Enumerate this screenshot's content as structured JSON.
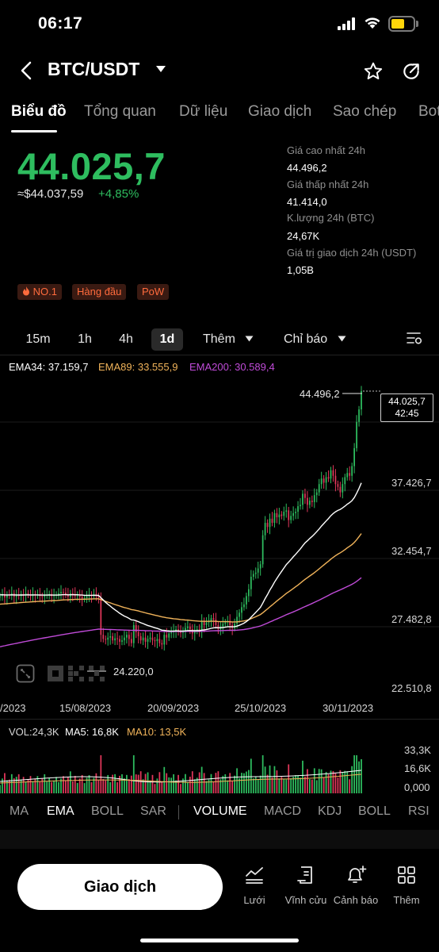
{
  "status_bar": {
    "time": "06:17"
  },
  "header": {
    "title": "BTC/USDT"
  },
  "tabs": [
    {
      "label": "Biểu đồ"
    },
    {
      "label": "Tổng quan"
    },
    {
      "label": "Dữ liệu"
    },
    {
      "label": "Giao dịch"
    },
    {
      "label": "Sao chép"
    },
    {
      "label": "Bot"
    }
  ],
  "price": {
    "last": "44.025,7",
    "usd": "≈$44.037,59",
    "change": "+4,85%",
    "up_color": "#2ebd5f"
  },
  "stats": [
    {
      "label": "Giá cao nhất 24h",
      "value": "44.496,2"
    },
    {
      "label": "Giá thấp nhất 24h",
      "value": "41.414,0"
    },
    {
      "label": "K.lượng 24h (BTC)",
      "value": "24,67K"
    },
    {
      "label": "Giá trị giao dịch 24h (USDT)",
      "value": "1,05B"
    }
  ],
  "badges": [
    {
      "label": "NO.1",
      "icon": "flame-icon"
    },
    {
      "label": "Hàng đầu"
    },
    {
      "label": "PoW"
    }
  ],
  "intervals": {
    "items": [
      "15m",
      "1h",
      "4h",
      "1d"
    ],
    "selected": "1d",
    "more_label": "Thêm",
    "indicator_label": "Chỉ báo"
  },
  "ema_legend": {
    "ema34": "EMA34: 37.159,7",
    "ema89": "EMA89: 33.555,9",
    "ema200": "EMA200: 30.589,4",
    "colors": {
      "ema34": "#ffffff",
      "ema89": "#f0b35a",
      "ema200": "#c04bd8"
    }
  },
  "chart": {
    "y_labels": [
      "37.426,7",
      "32.454,7",
      "27.482,8",
      "22.510,8"
    ],
    "x_labels": [
      "/2023",
      "15/08/2023",
      "20/09/2023",
      "25/10/2023",
      "30/11/2023"
    ],
    "last_price_tag": "44.025,7",
    "countdown": "42:45",
    "high_label": "44.496,2",
    "low_label": "24.220,0",
    "watermark": "OKX"
  },
  "chart_data": {
    "type": "candlestick",
    "title": "",
    "ylim": [
      22510.8,
      44496.2
    ],
    "y_ticks": [
      37426.7,
      32454.7,
      27482.8,
      22510.8
    ],
    "x_ticks": [
      "/2023",
      "15/08/2023",
      "20/09/2023",
      "25/10/2023",
      "30/11/2023"
    ],
    "close_series": [
      29200,
      29350,
      29100,
      29300,
      29250,
      29400,
      29150,
      29300,
      29200,
      29350,
      29250,
      29400,
      29300,
      29200,
      29350,
      29250,
      29300,
      29200,
      29150,
      29250,
      29300,
      29350,
      29200,
      29250,
      29300,
      29400,
      29500,
      29450,
      29300,
      29150,
      29400,
      29350,
      29200,
      29300,
      29150,
      29000,
      29050,
      29200,
      29300,
      29250,
      29350,
      29200,
      29100,
      26400,
      26100,
      26050,
      26200,
      26300,
      26000,
      26150,
      26100,
      25900,
      26000,
      26200,
      26400,
      26100,
      25800,
      27100,
      26600,
      26300,
      26000,
      26200,
      25900,
      26100,
      26200,
      26000,
      25950,
      26100,
      25800,
      25700,
      26400,
      26200,
      26500,
      26600,
      26700,
      26800,
      26600,
      26550,
      26700,
      26900,
      27000,
      26800,
      26500,
      26700,
      26800,
      26600,
      27400,
      27100,
      27300,
      27400,
      27600,
      27500,
      27100,
      26800,
      27000,
      27200,
      27300,
      27400,
      27100,
      26900,
      27200,
      27700,
      28000,
      28400,
      28600,
      29200,
      29700,
      30600,
      30800,
      30900,
      31200,
      31500,
      33600,
      34500,
      34200,
      34800,
      34500,
      35200,
      34900,
      35100,
      35000,
      35300,
      35400,
      34700,
      35000,
      35200,
      35300,
      35700,
      35800,
      36600,
      36300,
      35800,
      36100,
      36000,
      36500,
      36700,
      37300,
      37700,
      37400,
      37800,
      37700,
      38300,
      37900,
      37300,
      37100,
      36700,
      37300,
      37800,
      38100,
      37900,
      38600,
      39900,
      41800,
      42700,
      44025
    ]
  },
  "volume": {
    "legend": {
      "vol": "VOL:24,3K",
      "ma5": "MA5: 16,8K",
      "ma10": "MA10: 13,5K"
    },
    "axis": [
      "33,3K",
      "16,6K",
      "0,000"
    ]
  },
  "indicator_tabs": [
    "MA",
    "EMA",
    "BOLL",
    "SAR",
    "VOLUME",
    "MACD",
    "KDJ",
    "BOLL",
    "RSI"
  ],
  "bottom_bar": {
    "trade_label": "Giao dịch",
    "items": [
      {
        "label": "Lưới",
        "icon": "grid-bot-icon"
      },
      {
        "label": "Vĩnh cửu",
        "icon": "document-icon"
      },
      {
        "label": "Cảnh báo",
        "icon": "bell-plus-icon"
      },
      {
        "label": "Thêm",
        "icon": "apps-icon"
      }
    ]
  }
}
